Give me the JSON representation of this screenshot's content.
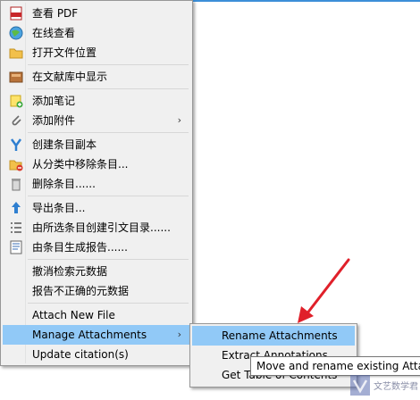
{
  "menu": {
    "items": [
      {
        "label": "查看 PDF",
        "icon": "pdf-icon"
      },
      {
        "label": "在线查看",
        "icon": "globe-icon"
      },
      {
        "label": "打开文件位置",
        "icon": "folder-icon"
      },
      {
        "label": "在文献库中显示",
        "icon": "library-icon"
      },
      {
        "label": "添加笔记",
        "icon": "note-icon"
      },
      {
        "label": "添加附件",
        "icon": "paperclip-icon",
        "submenu_arrow": "›"
      },
      {
        "label": "创建条目副本",
        "icon": "duplicate-icon"
      },
      {
        "label": "从分类中移除条目...",
        "icon": "remove-from-collection-icon"
      },
      {
        "label": "删除条目......",
        "icon": "trash-icon"
      },
      {
        "label": "导出条目...",
        "icon": "export-icon"
      },
      {
        "label": "由所选条目创建引文目录......",
        "icon": "bibliography-icon"
      },
      {
        "label": "由条目生成报告......",
        "icon": "report-icon"
      },
      {
        "label": "撤消检索元数据"
      },
      {
        "label": "报告不正确的元数据"
      },
      {
        "label": "Attach New File"
      },
      {
        "label": "Manage Attachments",
        "submenu_arrow": "›",
        "highlighted": true
      },
      {
        "label": "Update citation(s)"
      }
    ]
  },
  "submenu": {
    "items": [
      {
        "label": "Rename Attachments",
        "highlighted": true
      },
      {
        "label": "Extract Annotations"
      },
      {
        "label": "Get Table of Contents"
      }
    ]
  },
  "tooltip": {
    "text": "Move and rename existing Attachments"
  },
  "watermark": {
    "text": "文艺数学君"
  },
  "colors": {
    "highlight": "#91c9f7",
    "arrow": "#e0202a",
    "accent_line": "#3c8fd8"
  }
}
